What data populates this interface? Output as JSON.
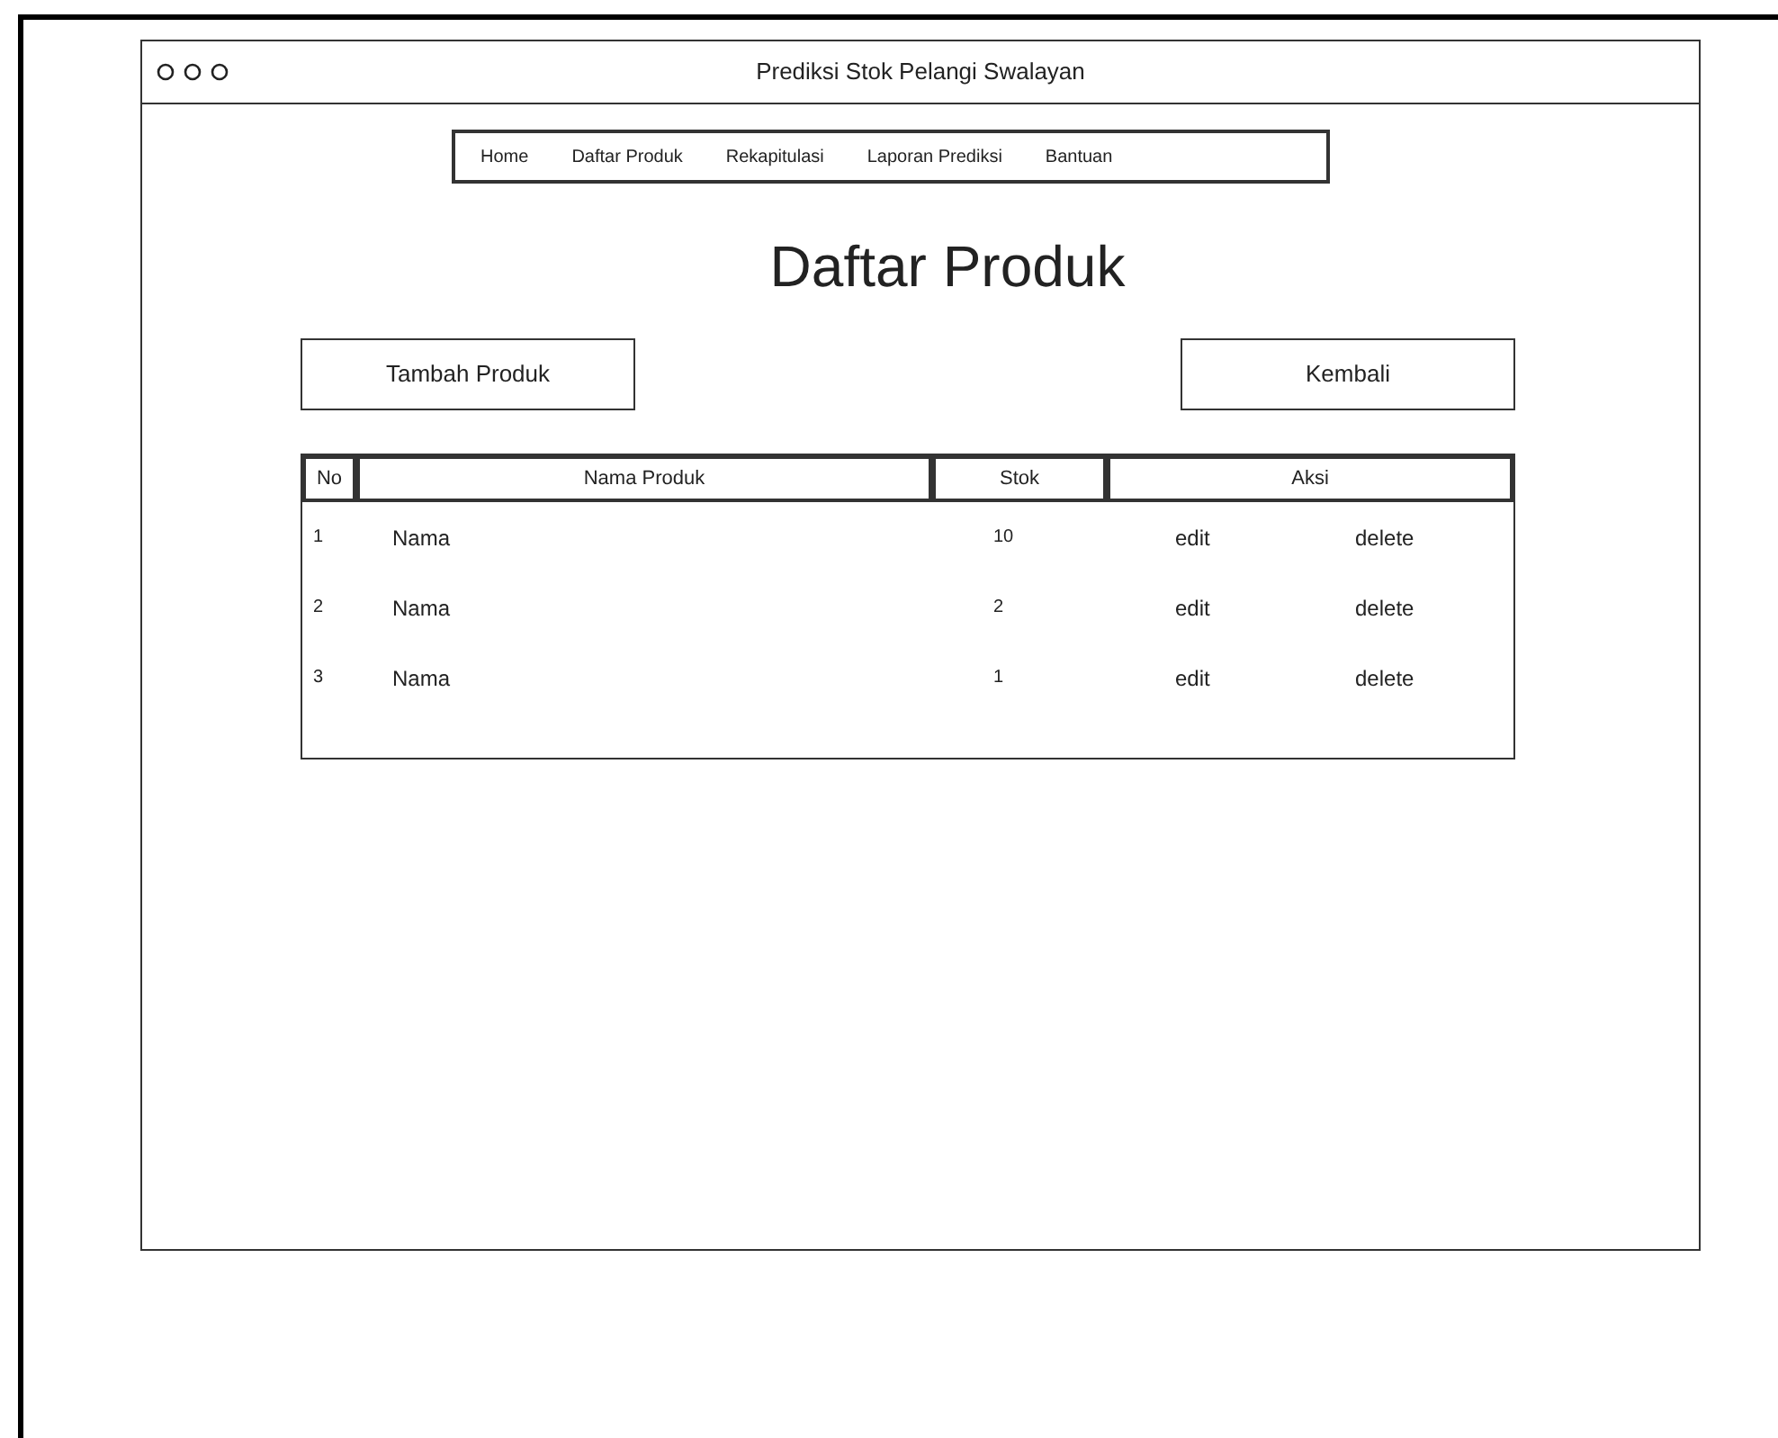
{
  "window": {
    "title": "Prediksi Stok Pelangi Swalayan"
  },
  "nav": [
    "Home",
    "Daftar Produk",
    "Rekapitulasi",
    "Laporan Prediksi",
    "Bantuan"
  ],
  "heading": "Daftar Produk",
  "buttons": {
    "add": "Tambah Produk",
    "back": "Kembali"
  },
  "table": {
    "columns": [
      "No",
      "Nama Produk",
      "Stok",
      "Aksi"
    ],
    "rows": [
      {
        "no": "1",
        "name": "Nama",
        "stock": "10",
        "edit": "edit",
        "delete": "delete"
      },
      {
        "no": "2",
        "name": "Nama",
        "stock": "2",
        "edit": "edit",
        "delete": "delete"
      },
      {
        "no": "3",
        "name": "Nama",
        "stock": "1",
        "edit": "edit",
        "delete": "delete"
      }
    ]
  }
}
